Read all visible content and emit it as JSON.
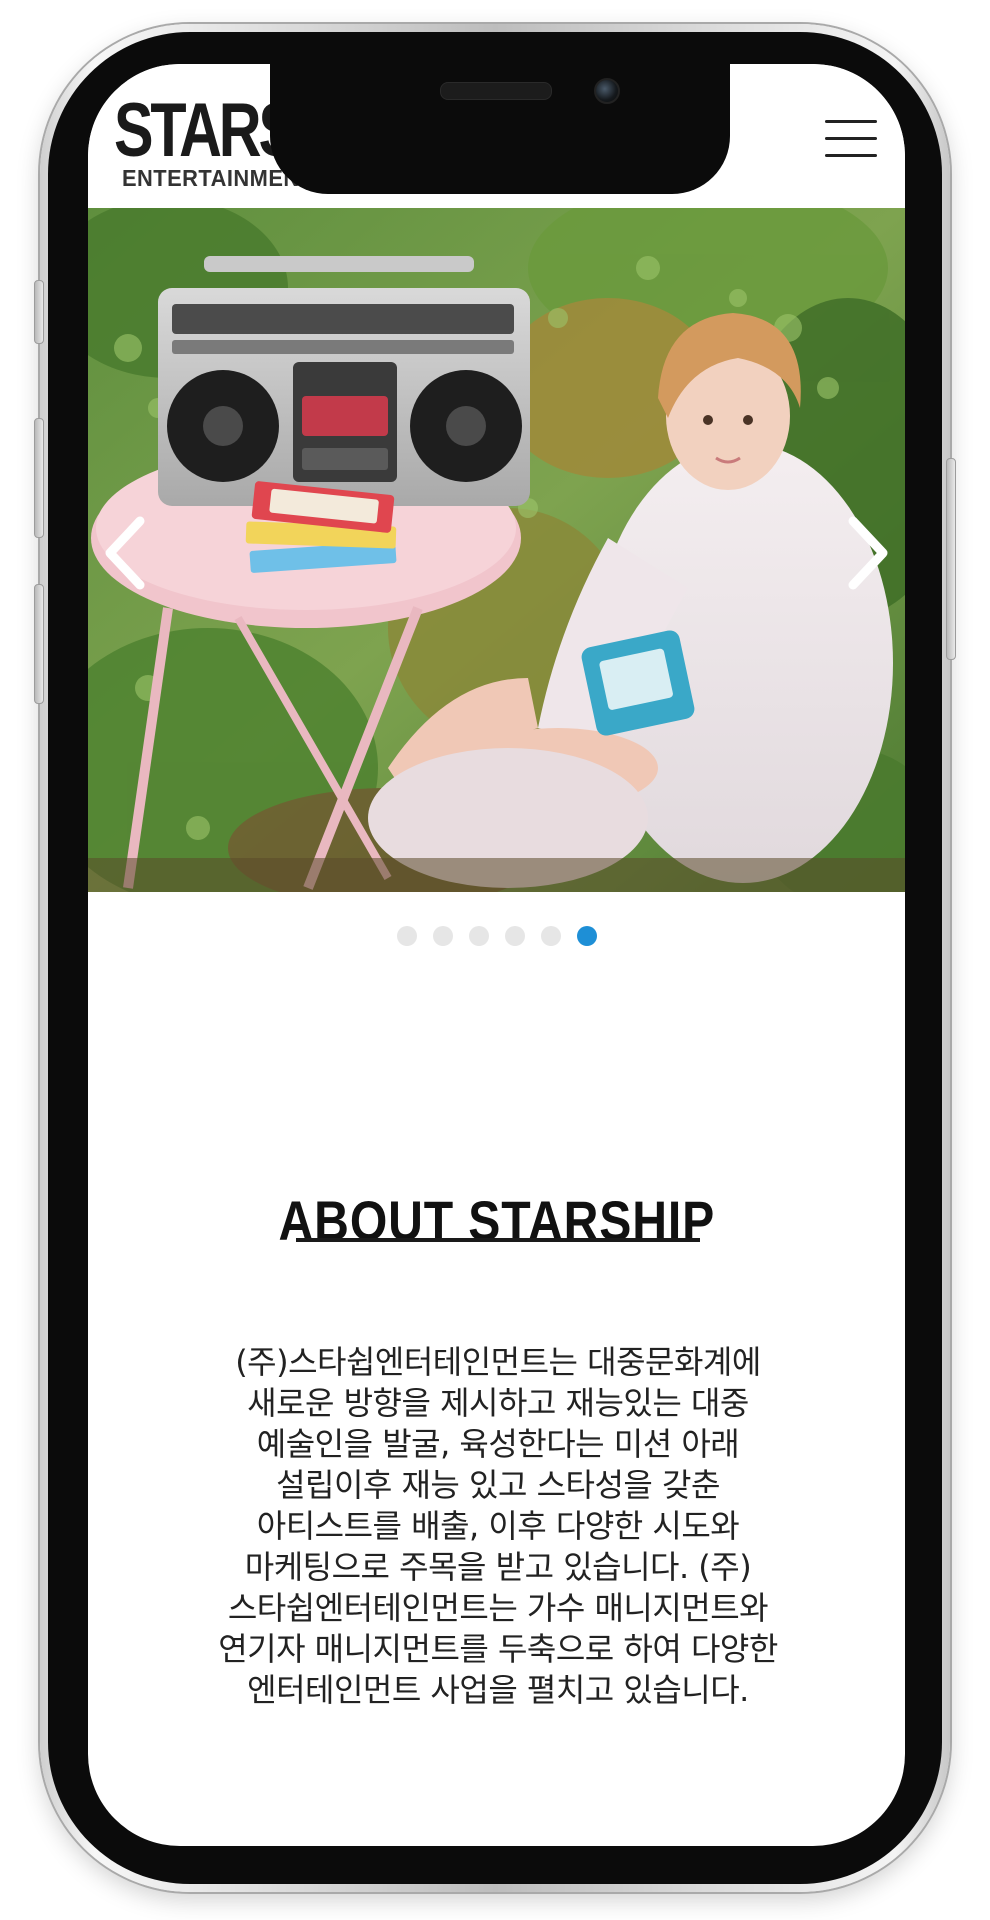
{
  "header": {
    "logo_main": "STARSHIP",
    "logo_sub": "ENTERTAINMENT",
    "menu_icon": "hamburger-menu-icon"
  },
  "hero": {
    "prev_icon": "chevron-left-icon",
    "next_icon": "chevron-right-icon",
    "slide_count": 6,
    "active_slide": 6
  },
  "about": {
    "title": "ABOUT STARSHIP",
    "body": "(주)스타쉽엔터테인먼트는 대중문화계에 새로운 방향을 제시하고 재능있는 대중 예술인을 발굴, 육성한다는 미션 아래 설립이후 재능 있고 스타성을 갖춘 아티스트를 배출, 이후 다양한 시도와 마케팅으로 주목을 받고 있습니다. (주)스타쉽엔터테인먼트는 가수 매니지먼트와 연기자 매니지먼트를 두축으로 하여 다양한 엔터테인먼트 사업을 펼치고 있습니다."
  },
  "colors": {
    "accent": "#1e8fd6",
    "inactive_dot": "#e6e6e6",
    "text": "#222222",
    "frame": "#0b0b0b"
  }
}
